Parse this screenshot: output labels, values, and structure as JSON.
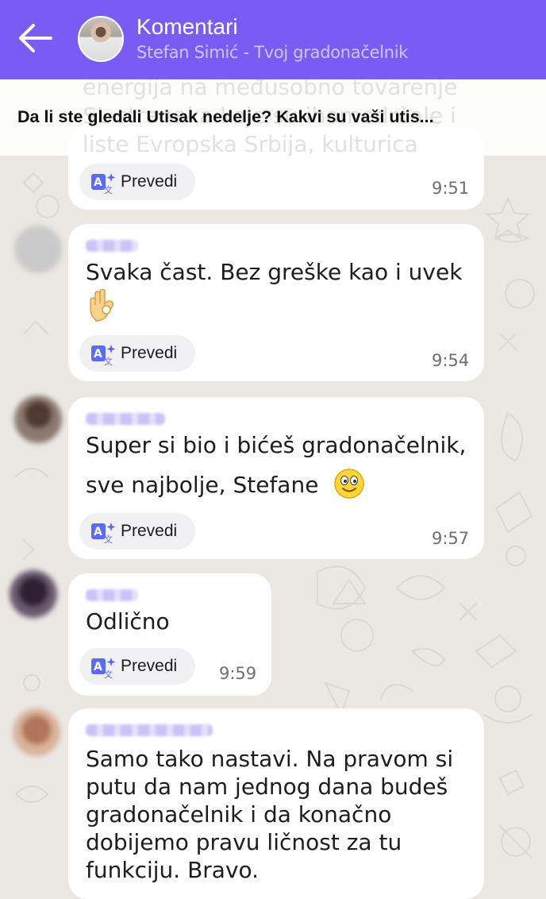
{
  "header": {
    "title": "Komentari",
    "subtitle": "Stefan Simić - Tvoj gradonačelnik",
    "back_icon": "arrow-left-icon",
    "accent_color": "#7a5cf5"
  },
  "pinned": {
    "question": "Da li ste gledali Utisak nedelje? Kakvi su vaši utis...",
    "background_text_line1": "energija na međusobno tovarenje",
    "background_text_line2": "SL stranaka koje su ihomedrčale i",
    "background_text_line3": "liste Evropska Srbija, kulturica"
  },
  "messages": [
    {
      "text": "",
      "translate_label": "Prevedi",
      "time": "9:51"
    },
    {
      "text": "Svaka čast. Bez greške kao i uvek",
      "emoji": "ok-hand-emoji",
      "translate_label": "Prevedi",
      "time": "9:54"
    },
    {
      "text_line1": "Super si bio i bićeš gradonačelnik,",
      "text_line2": "sve najbolje, Stefane",
      "emoji": "smiling-face-emoji",
      "translate_label": "Prevedi",
      "time": "9:57"
    },
    {
      "text": "Odlično",
      "translate_label": "Prevedi",
      "time": "9:59"
    },
    {
      "lines": [
        "Samo tako nastavi. Na pravom si",
        "putu da nam jednog dana budeš",
        "gradonačelnik i da konačno",
        "dobijemo pravu ličnost za tu",
        "funkciju. Bravo."
      ]
    }
  ]
}
